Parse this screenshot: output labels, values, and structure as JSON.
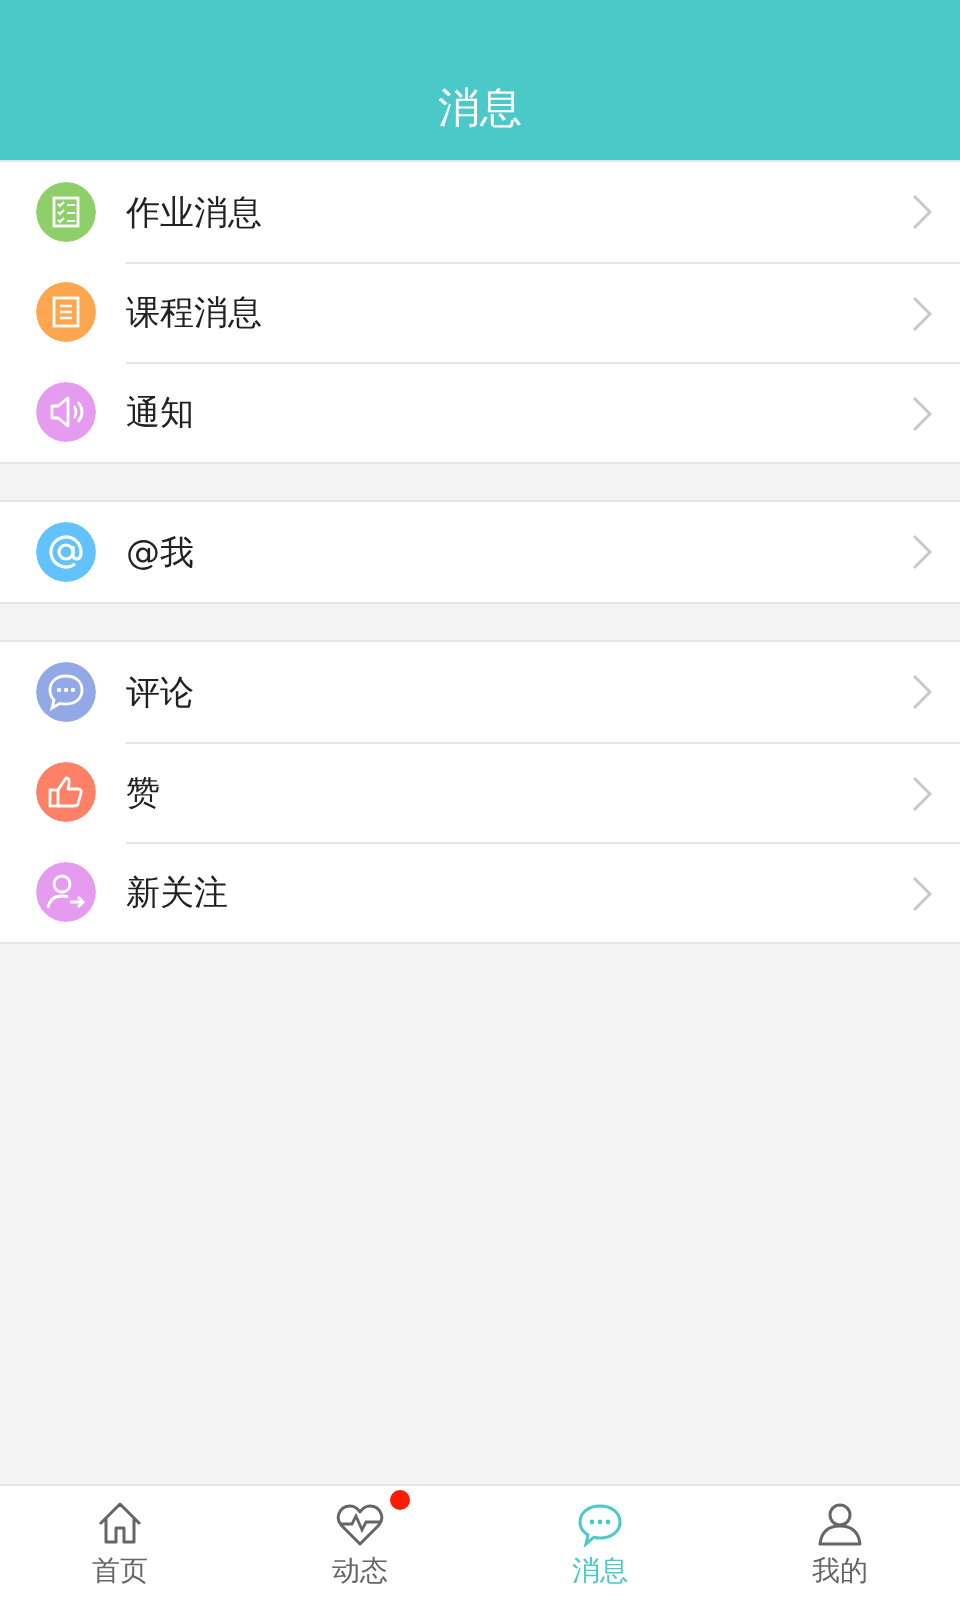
{
  "header": {
    "title": "消息"
  },
  "groups": [
    {
      "items": [
        {
          "label": "作业消息",
          "kind": "checklist",
          "color": "#8fcf6a"
        },
        {
          "label": "课程消息",
          "kind": "list",
          "color": "#fda650"
        },
        {
          "label": "通知",
          "kind": "speaker",
          "color": "#e59cf0"
        }
      ]
    },
    {
      "items": [
        {
          "label": "@我",
          "kind": "at",
          "color": "#62c2fb"
        }
      ]
    },
    {
      "items": [
        {
          "label": "评论",
          "kind": "comment",
          "color": "#93a8e6"
        },
        {
          "label": "赞",
          "kind": "thumb",
          "color": "#fd8166"
        },
        {
          "label": "新关注",
          "kind": "follow",
          "color": "#e59cf0"
        }
      ]
    }
  ],
  "tabs": [
    {
      "label": "首页",
      "kind": "home",
      "selected": false,
      "badge": false
    },
    {
      "label": "动态",
      "kind": "heart",
      "selected": false,
      "badge": true
    },
    {
      "label": "消息",
      "kind": "chat",
      "selected": true,
      "badge": false
    },
    {
      "label": "我的",
      "kind": "person",
      "selected": false,
      "badge": false
    }
  ]
}
